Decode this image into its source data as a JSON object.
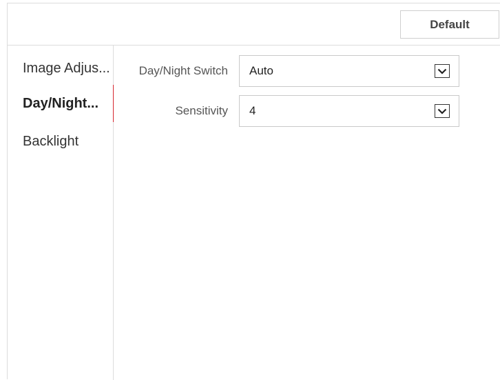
{
  "toolbar": {
    "default_label": "Default"
  },
  "sidebar": {
    "items": [
      {
        "label": "Image Adjus...",
        "active": false
      },
      {
        "label": "Day/Night...",
        "active": true
      },
      {
        "label": "Backlight",
        "active": false
      }
    ]
  },
  "form": {
    "day_night_switch": {
      "label": "Day/Night Switch",
      "value": "Auto"
    },
    "sensitivity": {
      "label": "Sensitivity",
      "value": "4"
    }
  },
  "colors": {
    "accent": "#d6252e",
    "border": "#dcdcdc"
  },
  "icons": {
    "dropdown": "chevron-down-icon"
  }
}
